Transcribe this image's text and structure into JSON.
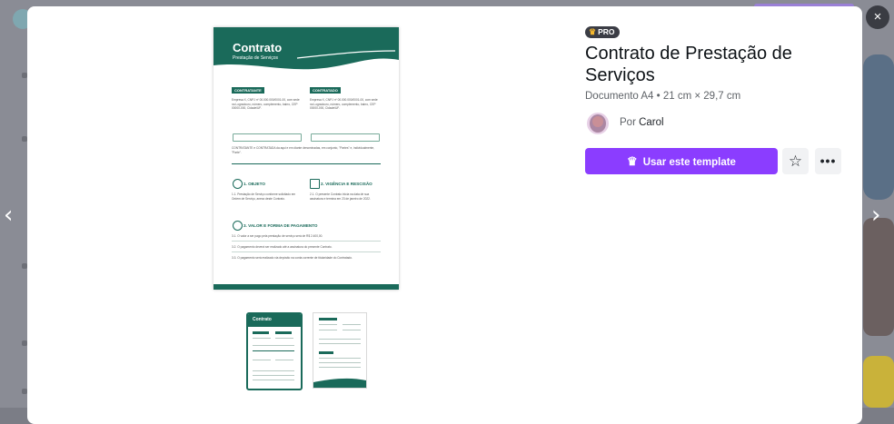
{
  "modal": {
    "badge": "PRO",
    "title": "Contrato de Prestação de Serviços",
    "meta": "Documento A4 • 21 cm × 29,7 cm",
    "author_prefix": "Por",
    "author_name": "Carol",
    "use_template_label": "Usar este template",
    "close_label": "×",
    "prev_label": "‹",
    "next_label": "›"
  },
  "preview": {
    "doc_title": "Contrato",
    "doc_subtitle": "Prestação de Serviços",
    "contratante_label": "CONTRATANTE",
    "contratado_label": "CONTRATADO",
    "contratante_text": "Empresa X, CNPJ nº 00.000.000/0001-00, com sede na Logradouro, número, complemento, bairro, CEP 00000-000, Cidade/UF.",
    "contratado_text": "Empresa X, CNPJ nº 00.000.000/0001-00, com sede na Logradouro, número, complemento, bairro, CEP 00000-000, Cidade/UF.",
    "parties_text": "CONTRATANTE e CONTRATADA da aqui e em diante denominadas, em conjunto, \"Partes\" e, individualmente, \"Parte\".",
    "section1_title": "1. OBJETO",
    "section1_text": "1.1. Prestação de Serviço conforme solicitado em Ordem de Serviço, anexa deste Contrato.",
    "section2_title": "2. VIGÊNCIA E RESCISÃO",
    "section2_text": "2.1. O presente Contrato inicia na data de sua assinatura e termina em 23 de janeiro de 2022.",
    "section3_title": "3. VALOR E FORMA DE PAGAMENTO",
    "section3_text1": "3.1. O valor a ser pago pela prestação de serviço será de R$ 2.400,00.",
    "section3_text2": "3.2. O pagamento deverá ser realizado até a assinatura do presente Contrato.",
    "section3_text3": "3.3. O pagamento será realizado via depósito na conta corrente de titularidade do Contratado.",
    "thumb1_title": "Contrato"
  },
  "colors": {
    "accent": "#8b3dff",
    "doc_green": "#1a6a5a",
    "pro_badge": "#3b3d45"
  },
  "icons": {
    "close": "close-icon",
    "prev": "chevron-left-icon",
    "next": "chevron-right-icon",
    "crown": "crown-icon",
    "star": "star-icon",
    "more": "more-horizontal-icon"
  }
}
